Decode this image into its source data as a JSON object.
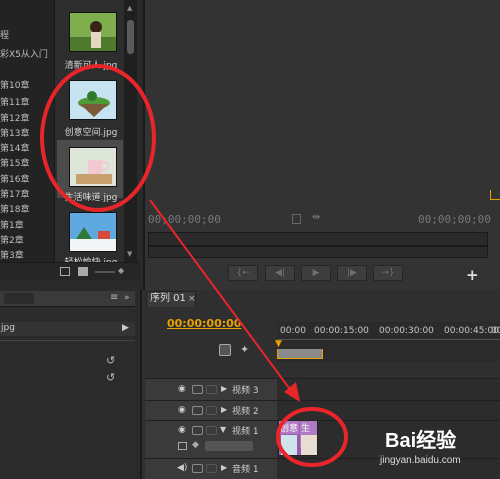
{
  "project": {
    "chapters_top": [
      "程",
      "彩X5从入门"
    ],
    "chapters": [
      "第10章",
      "第11章",
      "第12章",
      "第13章",
      "第14章",
      "第15章",
      "第16章",
      "第17章",
      "第18章",
      "第1章",
      "第2章",
      "第3章"
    ],
    "files": [
      {
        "label": "清新可人.jpg"
      },
      {
        "label": "创意空间.jpg"
      },
      {
        "label": "生活味道.jpg"
      },
      {
        "label": "轻松愉快.jpg"
      }
    ]
  },
  "monitor": {
    "tc_left": "00;00;00;00",
    "tc_right": "00;00;00;00",
    "buttons": [
      "{←",
      "◀|",
      "▶",
      "|▶",
      "→}"
    ],
    "add_button": "+"
  },
  "bottom_left": {
    "menu_icon": "≡",
    "item": "jpg"
  },
  "timeline": {
    "tab_label": "序列 01",
    "close": "×",
    "timecode": "00:00:00:00",
    "ruler": [
      "00:00",
      "00:00:15:00",
      "00:00:30:00",
      "00:00:45:00",
      "00"
    ],
    "tracks": [
      {
        "name": "视频 3"
      },
      {
        "name": "视频 2"
      },
      {
        "name": "视频 1"
      },
      {
        "name": "音频 1"
      }
    ],
    "clip_labels": [
      "创意",
      "生活"
    ]
  },
  "watermark": {
    "brand": "Bai经验",
    "url": "jingyan.baidu.com"
  },
  "colors": {
    "accent_orange": "#e8a100",
    "annotation_red": "#e8262a",
    "clip_purple": "#9a5bb0"
  }
}
